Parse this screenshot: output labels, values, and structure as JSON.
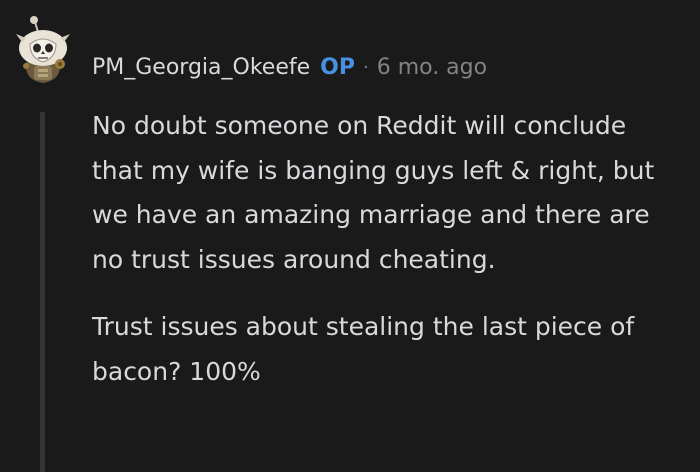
{
  "comment": {
    "author": "PM_Georgia_Okeefe",
    "op_badge": "OP",
    "separator": "·",
    "timestamp": "6 mo. ago",
    "paragraphs": [
      "No doubt someone on Reddit will conclude that my wife is banging guys left & right, but we have an amazing marriage and there are no trust issues around cheating.",
      "Trust issues about stealing the last piece of bacon? 100%"
    ]
  },
  "colors": {
    "background": "#1a1a1b",
    "text": "#d7dadc",
    "meta": "#818384",
    "op": "#4a90e2",
    "thread_line": "#343536"
  },
  "icons": {
    "avatar": "snoo-avatar-icon"
  }
}
